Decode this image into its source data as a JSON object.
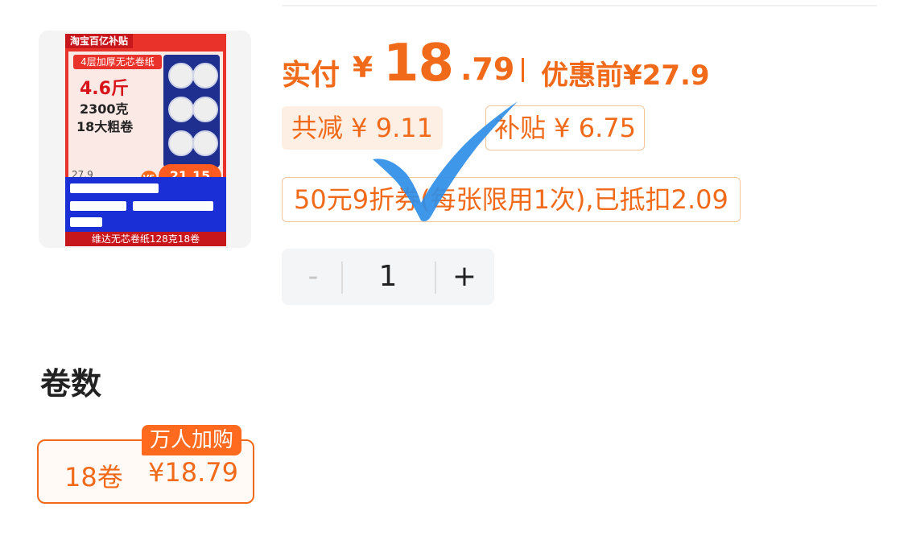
{
  "product": {
    "image": {
      "banner": "淘宝百亿补贴",
      "subtitle": "4层加厚无芯卷纸",
      "weight": "4.6斤",
      "grams": "2300克",
      "rolls": "18大粗卷",
      "old_price": "27.9",
      "vs": "VS",
      "new_price": "21.15",
      "footer": "维达无芯卷纸128克18卷"
    }
  },
  "pricing": {
    "actual_label": "实付",
    "currency": "¥",
    "actual_int": "18",
    "actual_dec": ".79",
    "before_label": "优惠前",
    "before_price": "¥27.9"
  },
  "discounts": {
    "total": "共减 ¥ 9.11",
    "subsidy": "补贴 ¥ 6.75",
    "coupon": "50元9折券(每张限用1次),已抵扣2.09"
  },
  "quantity": {
    "minus": "-",
    "value": "1",
    "plus": "+"
  },
  "section": {
    "title": "卷数",
    "options": [
      {
        "name": "18卷",
        "price": "¥18.79",
        "badge": "万人加购"
      }
    ]
  },
  "colors": {
    "accent": "#f06a1a",
    "chip_bg": "#fdefe3",
    "check": "#2f8ee8"
  }
}
